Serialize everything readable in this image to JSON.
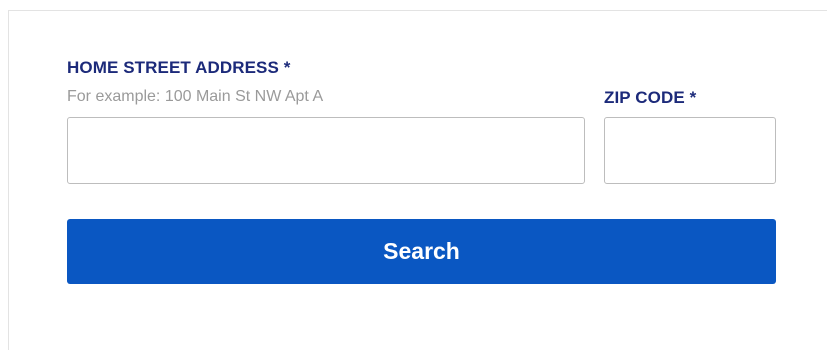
{
  "form": {
    "address_label": "HOME STREET ADDRESS *",
    "address_hint": "For example: 100 Main St NW Apt A",
    "address_value": "",
    "address_placeholder": "",
    "zip_label": "ZIP CODE *",
    "zip_value": "",
    "zip_placeholder": "",
    "search_label": "Search"
  },
  "colors": {
    "label": "#1c2a7a",
    "hint": "#9a9a9a",
    "button": "#0a57c2",
    "button_text": "#ffffff",
    "field_border": "#bdbdbd"
  }
}
